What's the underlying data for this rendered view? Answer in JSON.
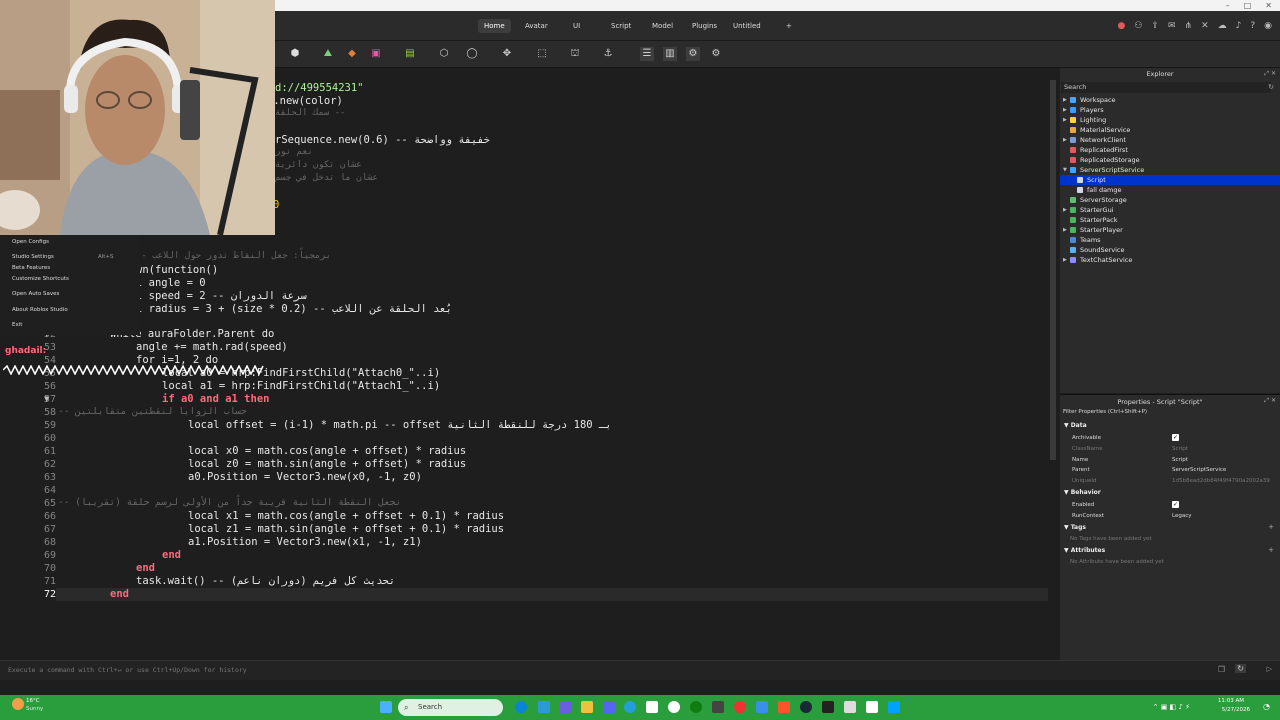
{
  "window": {
    "controls": [
      "–",
      "□",
      "✕"
    ]
  },
  "menubar": {
    "tabs": [
      {
        "label": "Home",
        "active": true
      },
      {
        "label": "Avatar"
      },
      {
        "label": "UI"
      },
      {
        "label": "Script"
      },
      {
        "label": "Model"
      },
      {
        "label": "Plugins"
      },
      {
        "label": "Untitled"
      },
      {
        "label": "+"
      }
    ]
  },
  "studio_menu": {
    "items": [
      {
        "label": "Open Configs"
      },
      {
        "label": "Studio Settings",
        "shortcut": "Alt+S"
      },
      {
        "label": "Beta Features"
      },
      {
        "label": "Customize Shortcuts"
      },
      {
        "label": "Open Auto Saves"
      },
      {
        "label": "About Roblox Studio"
      },
      {
        "label": "Exit"
      }
    ]
  },
  "chat": {
    "user": "ghadail:"
  },
  "editor": {
    "lines": [
      {
        "n": "",
        "code": "d://499554231\""
      },
      {
        "n": "",
        "code": "3.new(color)"
      },
      {
        "n": "",
        "code": "سمك الحلقة --"
      },
      {
        "n": "",
        "code": ""
      },
      {
        "n": "",
        "code": "rSequence.new(0.6) -- خفيفة وواضحة"
      },
      {
        "n": "",
        "code": "نعم نور"
      },
      {
        "n": "",
        "code": "عشان تكون دائرية"
      },
      {
        "n": "",
        "code": "عشان ما تدخل في جسم"
      },
      {
        "n": "",
        "code": "0"
      },
      {
        "n": "",
        "code": ""
      },
      {
        "n": "",
        "code": ""
      },
      {
        "n": "",
        "code": "-- برمجياً: جعل النقاط تدور حول اللاعب"
      },
      {
        "n": "",
        "code": "wn(function()"
      },
      {
        "n": "",
        "code": "l angle = 0"
      },
      {
        "n": "",
        "code": "l speed = 2 -- سرعة الدوران"
      },
      {
        "n": "",
        "code": "l radius = 3 + (size * 0.2) -- بُعد الحلقة عن اللاعب"
      },
      {
        "n": "52",
        "code": "while auraFolder.Parent do"
      },
      {
        "n": "53",
        "code": "angle += math.rad(speed)"
      },
      {
        "n": "54",
        "code": "for i=1, 2 do"
      },
      {
        "n": "55",
        "code": "local a0 = hrp:FindFirstChild(\"Attach0_\"..i)"
      },
      {
        "n": "56",
        "code": "local a1 = hrp:FindFirstChild(\"Attach1_\"..i)"
      },
      {
        "n": "57",
        "code": "if a0 and a1 then"
      },
      {
        "n": "58",
        "code": "-- حساب الزوايا لنقطتين متقابلتين"
      },
      {
        "n": "59",
        "code": "local offset = (i-1) * math.pi -- offset بـ 180 درجة للنقطة الثانية"
      },
      {
        "n": "60",
        "code": ""
      },
      {
        "n": "61",
        "code": "local x0 = math.cos(angle + offset) * radius"
      },
      {
        "n": "62",
        "code": "local z0 = math.sin(angle + offset) * radius"
      },
      {
        "n": "63",
        "code": "a0.Position = Vector3.new(x0, -1, z0)"
      },
      {
        "n": "64",
        "code": ""
      },
      {
        "n": "65",
        "code": "-- نجعل النقطة الثانية قريبة جداً من الأولى لرسم حلقة (تقريبا)"
      },
      {
        "n": "66",
        "code": "local x1 = math.cos(angle + offset + 0.1) * radius"
      },
      {
        "n": "67",
        "code": "local z1 = math.sin(angle + offset + 0.1) * radius"
      },
      {
        "n": "68",
        "code": "a1.Position = Vector3.new(x1, -1, z1)"
      },
      {
        "n": "69",
        "code": "end"
      },
      {
        "n": "70",
        "code": "end"
      },
      {
        "n": "71",
        "code": "task.wait() -- تحديث كل فريم (دوران ناعم)"
      },
      {
        "n": "72",
        "code": "end"
      }
    ]
  },
  "explorer": {
    "title": "Explorer",
    "search_placeholder": "Search",
    "items": [
      {
        "label": "Workspace",
        "color": "#4aa3ff"
      },
      {
        "label": "Players",
        "color": "#3a9cff"
      },
      {
        "label": "Lighting",
        "color": "#ffd23f"
      },
      {
        "label": "MaterialService",
        "color": "#e8a93c"
      },
      {
        "label": "NetworkClient",
        "color": "#7a9bd1"
      },
      {
        "label": "ReplicatedFirst",
        "color": "#e05b5b"
      },
      {
        "label": "ReplicatedStorage",
        "color": "#e05b5b"
      },
      {
        "label": "ServerScriptService",
        "color": "#3aa5ff"
      },
      {
        "label": "Script",
        "color": "#cfd8e3",
        "selected": true
      },
      {
        "label": "fall damge",
        "color": "#cfd8e3"
      },
      {
        "label": "ServerStorage",
        "color": "#5fbf6f"
      },
      {
        "label": "StarterGui",
        "color": "#4fb45f"
      },
      {
        "label": "StarterPack",
        "color": "#4fb45f"
      },
      {
        "label": "StarterPlayer",
        "color": "#4fb45f"
      },
      {
        "label": "Teams",
        "color": "#4f86d6"
      },
      {
        "label": "SoundService",
        "color": "#5bb0f0"
      },
      {
        "label": "TextChatService",
        "color": "#8c8cff"
      }
    ]
  },
  "properties": {
    "title": "Properties - Script \"Script\"",
    "filter_placeholder": "Filter Properties (Ctrl+Shift+P)",
    "sections": {
      "data": "Data",
      "behavior": "Behavior",
      "tags": "Tags",
      "attributes": "Attributes"
    },
    "rows": {
      "archivable": "Archivable",
      "classname": "ClassName",
      "classname_val": "Script",
      "name": "Name",
      "name_val": "Script",
      "parent": "Parent",
      "parent_val": "ServerScriptService",
      "uniqueid": "UniqueId",
      "uniqueid_val": "1d5b8ead2db84f49f4790a2002a39",
      "enabled": "Enabled",
      "runcontext": "RunContext",
      "runcontext_val": "Legacy",
      "no_tags": "No Tags have been added yet",
      "no_attrs": "No Attribute have been added yet"
    }
  },
  "command_bar": {
    "placeholder": "Execute a command with Ctrl+↵ or use Ctrl+Up/Down for history"
  },
  "taskbar": {
    "weather_temp": "16°C",
    "weather_text": "Sunny",
    "search": "Search",
    "time": "11:03 AM",
    "date": "5/27/2026"
  }
}
